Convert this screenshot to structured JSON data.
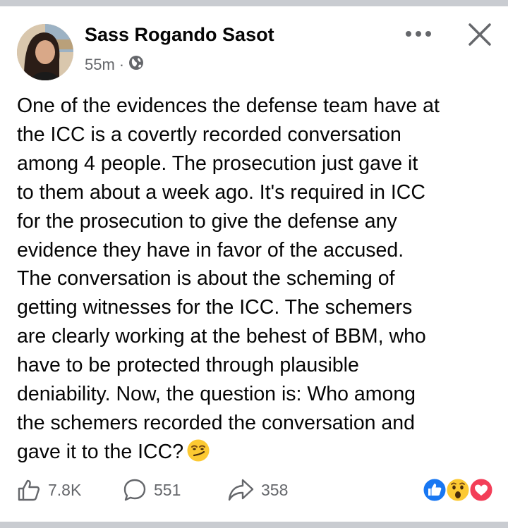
{
  "post": {
    "author": "Sass Rogando Sasot",
    "time": "55m",
    "separator": "·",
    "privacy_icon": "globe-icon",
    "lines": [
      "One of the evidences the defense team have at",
      "the ICC is a covertly recorded conversation",
      "among 4 people. The prosecution just gave it",
      "to them about a week ago. It's required in ICC",
      "for the prosecution to give the defense any",
      "evidence they have in favor of the accused.",
      "The conversation is about the scheming of",
      "getting witnesses for the ICC. The schemers",
      "are clearly working at the behest of BBM, who",
      "have to be protected through plausible",
      "deniability. Now, the question is: Who among",
      "the schemers recorded the conversation and",
      "gave it to the ICC?"
    ],
    "trailing_emoji": "smirking-face-icon"
  },
  "header": {
    "more_icon": "more-horizontal-icon",
    "close_icon": "close-icon"
  },
  "actions": {
    "like_count": "7.8K",
    "comment_count": "551",
    "share_count": "358"
  },
  "reactions": [
    "like-reaction-icon",
    "wow-reaction-icon",
    "love-reaction-icon"
  ],
  "colors": {
    "primary_text": "#050505",
    "secondary_text": "#65676b",
    "like_blue": "#1877f2",
    "love_red": "#f33e58",
    "wow_yellow": "#fcc932",
    "divider": "#c9ccd1"
  }
}
